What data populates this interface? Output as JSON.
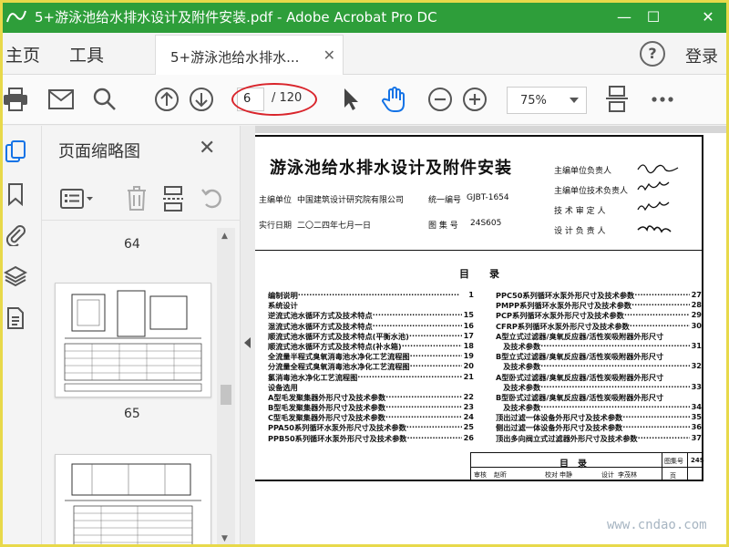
{
  "window": {
    "title": "5+游泳池给水排水设计及附件安装.pdf - Adobe Acrobat Pro DC",
    "minimize": "—",
    "maximize": "☐",
    "close": "✕"
  },
  "tabs": {
    "home": "主页",
    "tools": "工具",
    "document_tab": "5+游泳池给水排水...",
    "close": "✕",
    "help": "?",
    "login": "登录"
  },
  "toolbar": {
    "current_page": "6",
    "total_pages": "/ 120",
    "zoom": "75%"
  },
  "panel": {
    "title": "页面缩略图",
    "close": "✕",
    "thumbnails": [
      {
        "page": "64"
      },
      {
        "page": "65"
      }
    ]
  },
  "document": {
    "title": "游泳池给水排水设计及附件安装",
    "org_label": "主编单位",
    "org": "中国建筑设计研究院有限公司",
    "date_label": "实行日期",
    "date": "二〇二四年七月一日",
    "code_label": "统一编号",
    "code": "GJBT-1654",
    "atlas_label": "图 集 号",
    "atlas": "24S605",
    "roles": [
      "主编单位负责人",
      "主编单位技术负责人",
      "技 术 审 定 人",
      "设 计 负 责 人"
    ],
    "toc_heading": "目　　录",
    "toc_left": [
      {
        "t": "编制说明",
        "n": "1",
        "head": true
      },
      {
        "t": "系统设计",
        "n": "",
        "head": true
      },
      {
        "t": "逆流式池水循环方式及技术特点",
        "n": "15"
      },
      {
        "t": "混流式池水循环方式及技术特点",
        "n": "16"
      },
      {
        "t": "顺流式池水循环方式及技术特点(平衡水池)",
        "n": "17"
      },
      {
        "t": "顺流式池水循环方式及技术特点(补水箱)",
        "n": "18"
      },
      {
        "t": "全流量半程式臭氧消毒池水净化工艺流程图",
        "n": "19"
      },
      {
        "t": "分流量全程式臭氧消毒池水净化工艺流程图",
        "n": "20"
      },
      {
        "t": "氯消毒池水净化工艺流程图",
        "n": "21"
      },
      {
        "t": "设备选用",
        "n": "",
        "head": true
      },
      {
        "t": "A型毛发聚集器外形尺寸及技术参数",
        "n": "22"
      },
      {
        "t": "B型毛发聚集器外形尺寸及技术参数",
        "n": "23"
      },
      {
        "t": "C型毛发聚集器外形尺寸及技术参数",
        "n": "24"
      },
      {
        "t": "PPA50系列循环水泵外形尺寸及技术参数",
        "n": "25"
      },
      {
        "t": "PPB50系列循环水泵外形尺寸及技术参数",
        "n": "26"
      }
    ],
    "toc_right": [
      {
        "t": "PPC50系列循环水泵外形尺寸及技术参数",
        "n": "27"
      },
      {
        "t": "PMPP系列循环水泵外形尺寸及技术参数",
        "n": "28"
      },
      {
        "t": "PCP系列循环水泵外形尺寸及技术参数",
        "n": "29"
      },
      {
        "t": "CFRP系列循环水泵外形尺寸及技术参数",
        "n": "30"
      },
      {
        "t": "A型立式过滤器/臭氧反应器/活性炭吸附器外形尺寸",
        "n": "",
        "head": true
      },
      {
        "t": "　及技术参数",
        "n": "31"
      },
      {
        "t": "B型立式过滤器/臭氧反应器/活性炭吸附器外形尺寸",
        "n": "",
        "head": true
      },
      {
        "t": "　及技术参数",
        "n": "32"
      },
      {
        "t": "A型卧式过滤器/臭氧反应器/活性炭吸附器外形尺寸",
        "n": "",
        "head": true
      },
      {
        "t": "　及技术参数",
        "n": "33"
      },
      {
        "t": "B型卧式过滤器/臭氧反应器/活性炭吸附器外形尺寸",
        "n": "",
        "head": true
      },
      {
        "t": "　及技术参数",
        "n": "34"
      },
      {
        "t": "顶出过滤一体设备外形尺寸及技术参数",
        "n": "35"
      },
      {
        "t": "侧出过滤一体设备外形尺寸及技术参数",
        "n": "36"
      },
      {
        "t": "顶出多向阀立式过滤器外形尺寸及技术参数",
        "n": "37"
      }
    ],
    "titleblock": {
      "name": "目　录",
      "atlas_no_label": "图集号",
      "atlas_no": "24S",
      "page_label": "页",
      "row": [
        "审核",
        "赵昕",
        "",
        "校对",
        "申静",
        "",
        "设计",
        "李茂林",
        ""
      ]
    }
  },
  "watermark": "www.cndao.com",
  "colors": {
    "titlebar": "#2e9e3a",
    "accent": "#1473e6",
    "highlight_ring": "#d9242b"
  }
}
